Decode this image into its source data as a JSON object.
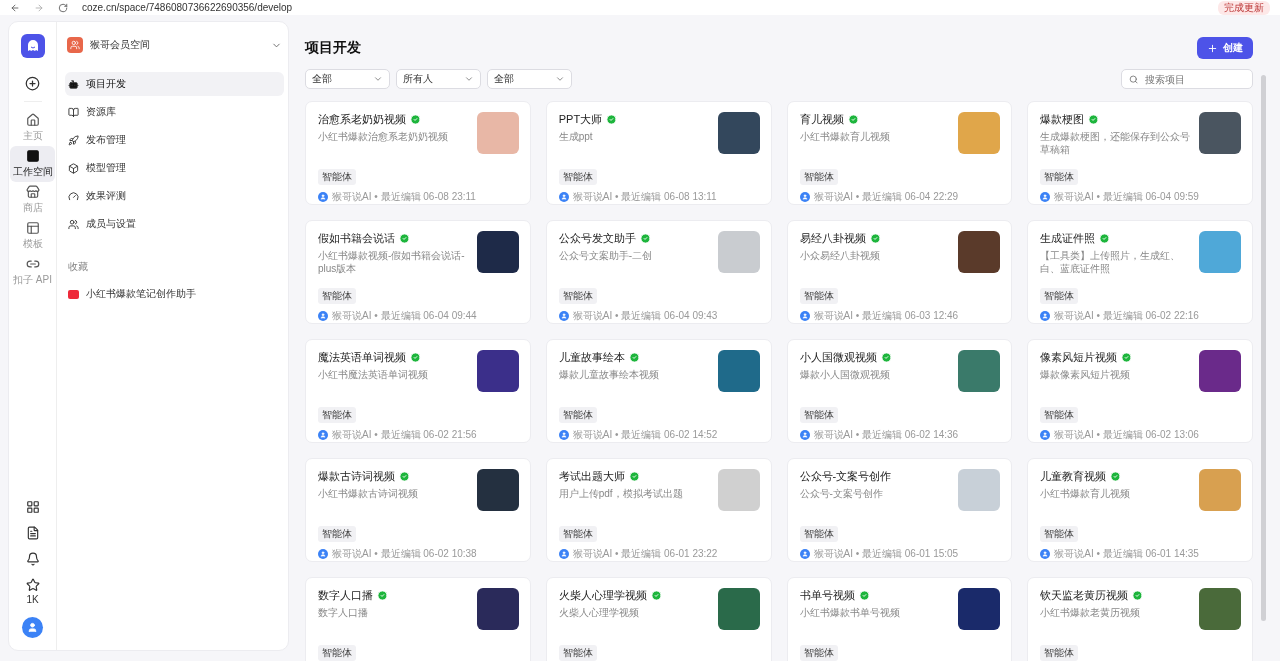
{
  "browser": {
    "url": "coze.cn/space/7486080736622690356/develop",
    "update_button": "完成更新"
  },
  "rail": {
    "items": [
      {
        "kind": "home",
        "label": "主页",
        "selected": false
      },
      {
        "kind": "workspace",
        "label": "工作空间",
        "selected": true
      },
      {
        "kind": "store",
        "label": "商店",
        "selected": false
      },
      {
        "kind": "template",
        "label": "模板",
        "selected": false
      },
      {
        "kind": "api",
        "label": "扣子 API",
        "selected": false
      }
    ],
    "bottom": [
      {
        "kind": "apps"
      },
      {
        "kind": "docs"
      },
      {
        "kind": "bell"
      },
      {
        "kind": "badge",
        "label": "1K"
      },
      {
        "kind": "avatar"
      }
    ]
  },
  "sidebar": {
    "space": "猴哥会员空间",
    "items": [
      {
        "kind": "dev",
        "label": "项目开发",
        "selected": true
      },
      {
        "kind": "library",
        "label": "资源库",
        "selected": false
      },
      {
        "kind": "publish",
        "label": "发布管理",
        "selected": false
      },
      {
        "kind": "model",
        "label": "模型管理",
        "selected": false
      },
      {
        "kind": "eval",
        "label": "效果评测",
        "selected": false
      },
      {
        "kind": "members",
        "label": "成员与设置",
        "selected": false
      }
    ],
    "favorites_title": "收藏",
    "favorites": [
      {
        "label": "小红书爆款笔记创作助手"
      }
    ]
  },
  "main": {
    "title": "项目开发",
    "create_button": "创建",
    "filters": [
      "全部",
      "所有人",
      "全部"
    ],
    "search": {
      "placeholder": "搜索项目"
    },
    "cards": [
      {
        "title": "治愈系老奶奶视频",
        "verified": true,
        "description": "小红书爆款治愈系老奶奶视频",
        "tag": "智能体",
        "meta": "猴哥说AI • 最近编辑 06-08 23:11"
      },
      {
        "title": "PPT大师",
        "verified": true,
        "description": "生成ppt",
        "tag": "智能体",
        "meta": "猴哥说AI • 最近编辑 06-08 13:11"
      },
      {
        "title": "育儿视频",
        "verified": true,
        "description": "小红书爆款育儿视频",
        "tag": "智能体",
        "meta": "猴哥说AI • 最近编辑 06-04 22:29"
      },
      {
        "title": "爆款梗图",
        "verified": true,
        "description": "生成爆款梗图，还能保存到公众号草稿箱",
        "tag": "智能体",
        "meta": "猴哥说AI • 最近编辑 06-04 09:59"
      },
      {
        "title": "假如书籍会说话",
        "verified": true,
        "description": "小红书爆款视频-假如书籍会说话-plus版本",
        "tag": "智能体",
        "meta": "猴哥说AI • 最近编辑 06-04 09:44"
      },
      {
        "title": "公众号发文助手",
        "verified": true,
        "description": "公众号文案助手-二创",
        "tag": "智能体",
        "meta": "猴哥说AI • 最近编辑 06-04 09:43"
      },
      {
        "title": "易经八卦视频",
        "verified": true,
        "description": "小众易经八卦视频",
        "tag": "智能体",
        "meta": "猴哥说AI • 最近编辑 06-03 12:46"
      },
      {
        "title": "生成证件照",
        "verified": true,
        "description": "【工具类】上传照片，生成红、白、蓝底证件照",
        "tag": "智能体",
        "meta": "猴哥说AI • 最近编辑 06-02 22:16"
      },
      {
        "title": "魔法英语单词视频",
        "verified": true,
        "description": "小红书魔法英语单词视频",
        "tag": "智能体",
        "meta": "猴哥说AI • 最近编辑 06-02 21:56"
      },
      {
        "title": "儿童故事绘本",
        "verified": true,
        "description": "爆款儿童故事绘本视频",
        "tag": "智能体",
        "meta": "猴哥说AI • 最近编辑 06-02 14:52"
      },
      {
        "title": "小人国微观视频",
        "verified": true,
        "description": "爆款小人国微观视频",
        "tag": "智能体",
        "meta": "猴哥说AI • 最近编辑 06-02 14:36"
      },
      {
        "title": "像素风短片视频",
        "verified": true,
        "description": "爆款像素风短片视频",
        "tag": "智能体",
        "meta": "猴哥说AI • 最近编辑 06-02 13:06"
      },
      {
        "title": "爆款古诗词视频",
        "verified": true,
        "description": "小红书爆款古诗词视频",
        "tag": "智能体",
        "meta": "猴哥说AI • 最近编辑 06-02 10:38"
      },
      {
        "title": "考试出题大师",
        "verified": true,
        "description": "用户上传pdf，模拟考试出题",
        "tag": "智能体",
        "meta": "猴哥说AI • 最近编辑 06-01 23:22"
      },
      {
        "title": "公众号-文案号创作",
        "verified": false,
        "description": "公众号-文案号创作",
        "tag": "智能体",
        "meta": "猴哥说AI • 最近编辑 06-01 15:05"
      },
      {
        "title": "儿童教育视频",
        "verified": true,
        "description": "小红书爆款育儿视频",
        "tag": "智能体",
        "meta": "猴哥说AI • 最近编辑 06-01 14:35"
      },
      {
        "title": "数字人口播",
        "verified": true,
        "description": "数字人口播",
        "tag": "智能体"
      },
      {
        "title": "火柴人心理学视频",
        "verified": true,
        "description": "火柴人心理学视频",
        "tag": "智能体"
      },
      {
        "title": "书单号视频",
        "verified": true,
        "description": "小红书爆款书单号视频",
        "tag": "智能体"
      },
      {
        "title": "钦天监老黄历视频",
        "verified": true,
        "description": "小红书爆款老黄历视频",
        "tag": "智能体"
      }
    ]
  }
}
